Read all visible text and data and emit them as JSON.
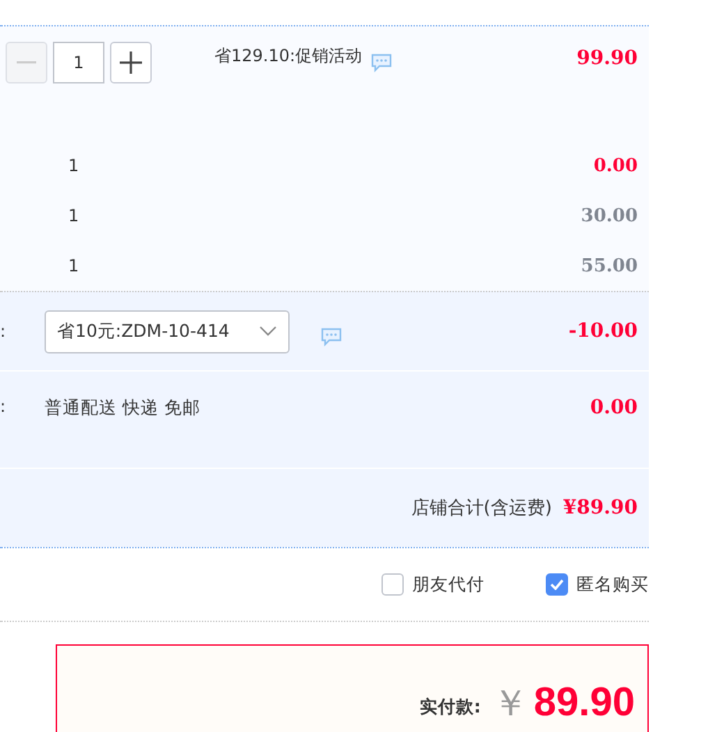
{
  "item": {
    "quantity": "1",
    "minus_disabled": true,
    "promo": "省129.10:促销活动",
    "price": "99.90"
  },
  "sub_items": [
    {
      "quantity": "1",
      "price": "0.00",
      "kind": "free"
    },
    {
      "quantity": "1",
      "price": "30.00",
      "kind": "paid"
    },
    {
      "quantity": "1",
      "price": "55.00",
      "kind": "paid"
    }
  ],
  "coupon": {
    "label": ":",
    "value": "省10元:ZDM-10-414",
    "amount": "-10.00"
  },
  "shipping": {
    "label": ":",
    "value": "普通配送 快递 免邮",
    "amount": "0.00"
  },
  "store_total": {
    "label": "店铺合计(含运费)",
    "amount": "¥89.90"
  },
  "options": [
    {
      "label": "朋友代付",
      "checked": false
    },
    {
      "label": "匿名购买",
      "checked": true
    }
  ],
  "payment": {
    "label": "实付款:",
    "currency": "￥",
    "amount": "89.90"
  }
}
